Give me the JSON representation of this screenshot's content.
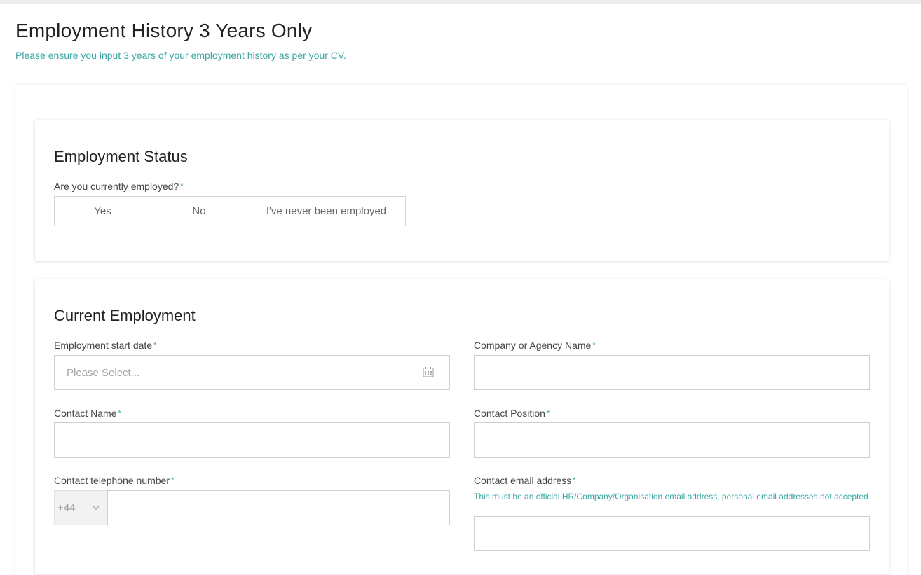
{
  "page": {
    "title": "Employment History 3 Years Only",
    "subtitle": "Please ensure you input 3 years of your employment history as per your CV."
  },
  "employment_status": {
    "heading": "Employment Status",
    "question": "Are you currently employed?",
    "options": [
      "Yes",
      "No",
      "I've never been employed"
    ]
  },
  "current_employment": {
    "heading": "Current Employment",
    "start_date": {
      "label": "Employment start date",
      "placeholder": "Please Select...",
      "value": ""
    },
    "company": {
      "label": "Company or Agency Name",
      "value": ""
    },
    "contact_name": {
      "label": "Contact Name",
      "value": ""
    },
    "contact_position": {
      "label": "Contact Position",
      "value": ""
    },
    "contact_phone": {
      "label": "Contact telephone number",
      "country_code": "+44",
      "value": ""
    },
    "contact_email": {
      "label": "Contact email address",
      "note": "This must be an official HR/Company/Organisation email address, personal email addresses not accepted",
      "value": ""
    }
  },
  "required_marker": "*",
  "icons": {
    "date_picker": "calendar-icon",
    "country_dropdown": "chevron-down-icon"
  },
  "colors": {
    "accent": "#3aa7a3",
    "title": "#222222",
    "border": "#cfcfcf"
  }
}
